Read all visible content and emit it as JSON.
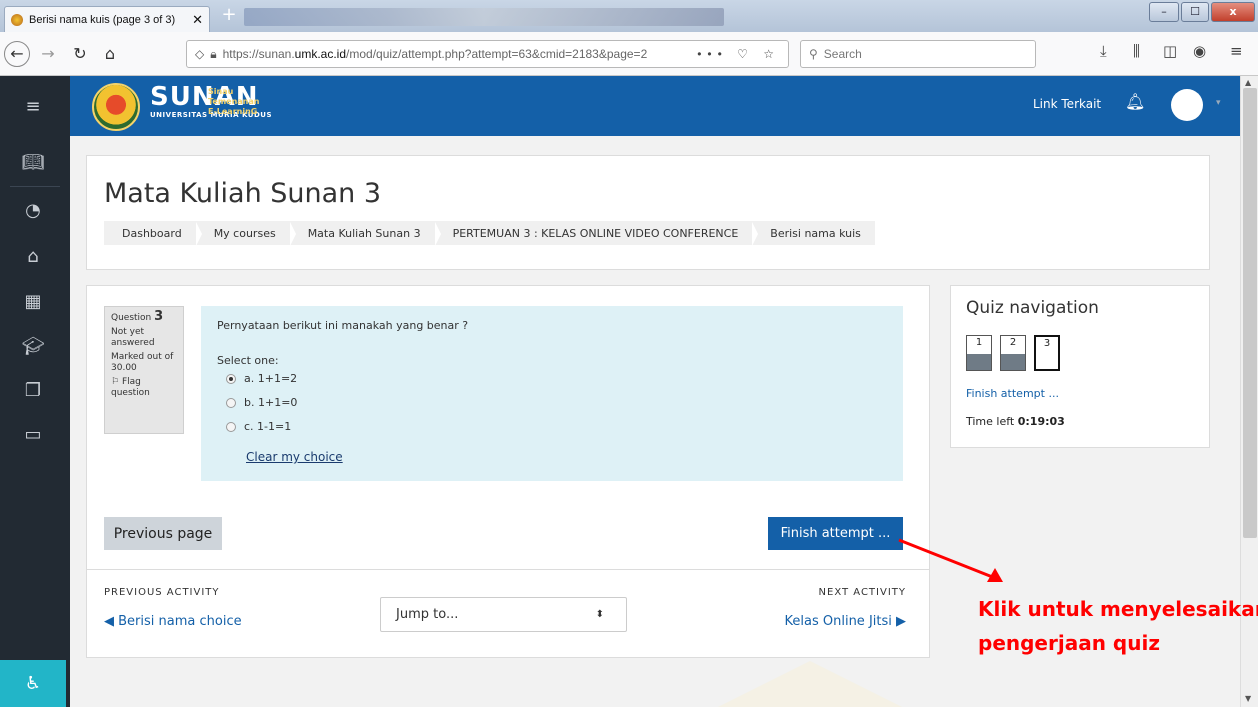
{
  "browser": {
    "tab_title": "Berisi nama kuis (page 3 of 3)",
    "tab_close": "✕",
    "new_tab": "+",
    "url_prefix": "https://sunan.",
    "url_domain": "umk.ac.id",
    "url_path": "/mod/quiz/attempt.php?attempt=63&cmid=2183&page=2",
    "url_more": "•••",
    "search_placeholder": "Search",
    "win_min": "–",
    "win_max": "☐",
    "win_close": "x"
  },
  "site": {
    "brand_name": "SUNAN",
    "brand_sub": "UNIVERSITAS MURIA KUDUS",
    "brand_tagline": "Sinau Temenanan E-LearninG",
    "link_terkait": "Link Terkait"
  },
  "header": {
    "title": "Mata Kuliah Sunan 3",
    "breadcrumbs": [
      "Dashboard",
      "My courses",
      "Mata Kuliah Sunan 3",
      "PERTEMUAN 3 : KELAS ONLINE VIDEO CONFERENCE",
      "Berisi nama kuis"
    ]
  },
  "question": {
    "label": "Question",
    "number": "3",
    "state": "Not yet answered",
    "marked": "Marked out of 30.00",
    "flag": "Flag question",
    "text": "Pernyataan berikut ini manakah yang benar ?",
    "select_one": "Select one:",
    "options": [
      {
        "label": "a. 1+1=2",
        "selected": true
      },
      {
        "label": "b. 1+1=0",
        "selected": false
      },
      {
        "label": "c. 1-1=1",
        "selected": false
      }
    ],
    "clear_choice": "Clear my choice"
  },
  "actions": {
    "previous_page": "Previous page",
    "finish_attempt": "Finish attempt ..."
  },
  "activity_nav": {
    "previous_label": "PREVIOUS ACTIVITY",
    "previous_link": "◀ Berisi nama choice",
    "jump_to": "Jump to...",
    "next_label": "NEXT ACTIVITY",
    "next_link": "Kelas Online Jitsi ▶"
  },
  "quiz_nav": {
    "title": "Quiz navigation",
    "buttons": [
      "1",
      "2",
      "3"
    ],
    "finish_link": "Finish attempt ...",
    "time_left_label": "Time left",
    "time_left_value": "0:19:03"
  },
  "annotation": {
    "line1": "Klik untuk menyelesaikan",
    "line2": "pengerjaan quiz",
    "color": "#ff0000"
  },
  "colors": {
    "accent": "#1460a8",
    "drawer": "#222a33",
    "question_bg": "#def1f6"
  }
}
